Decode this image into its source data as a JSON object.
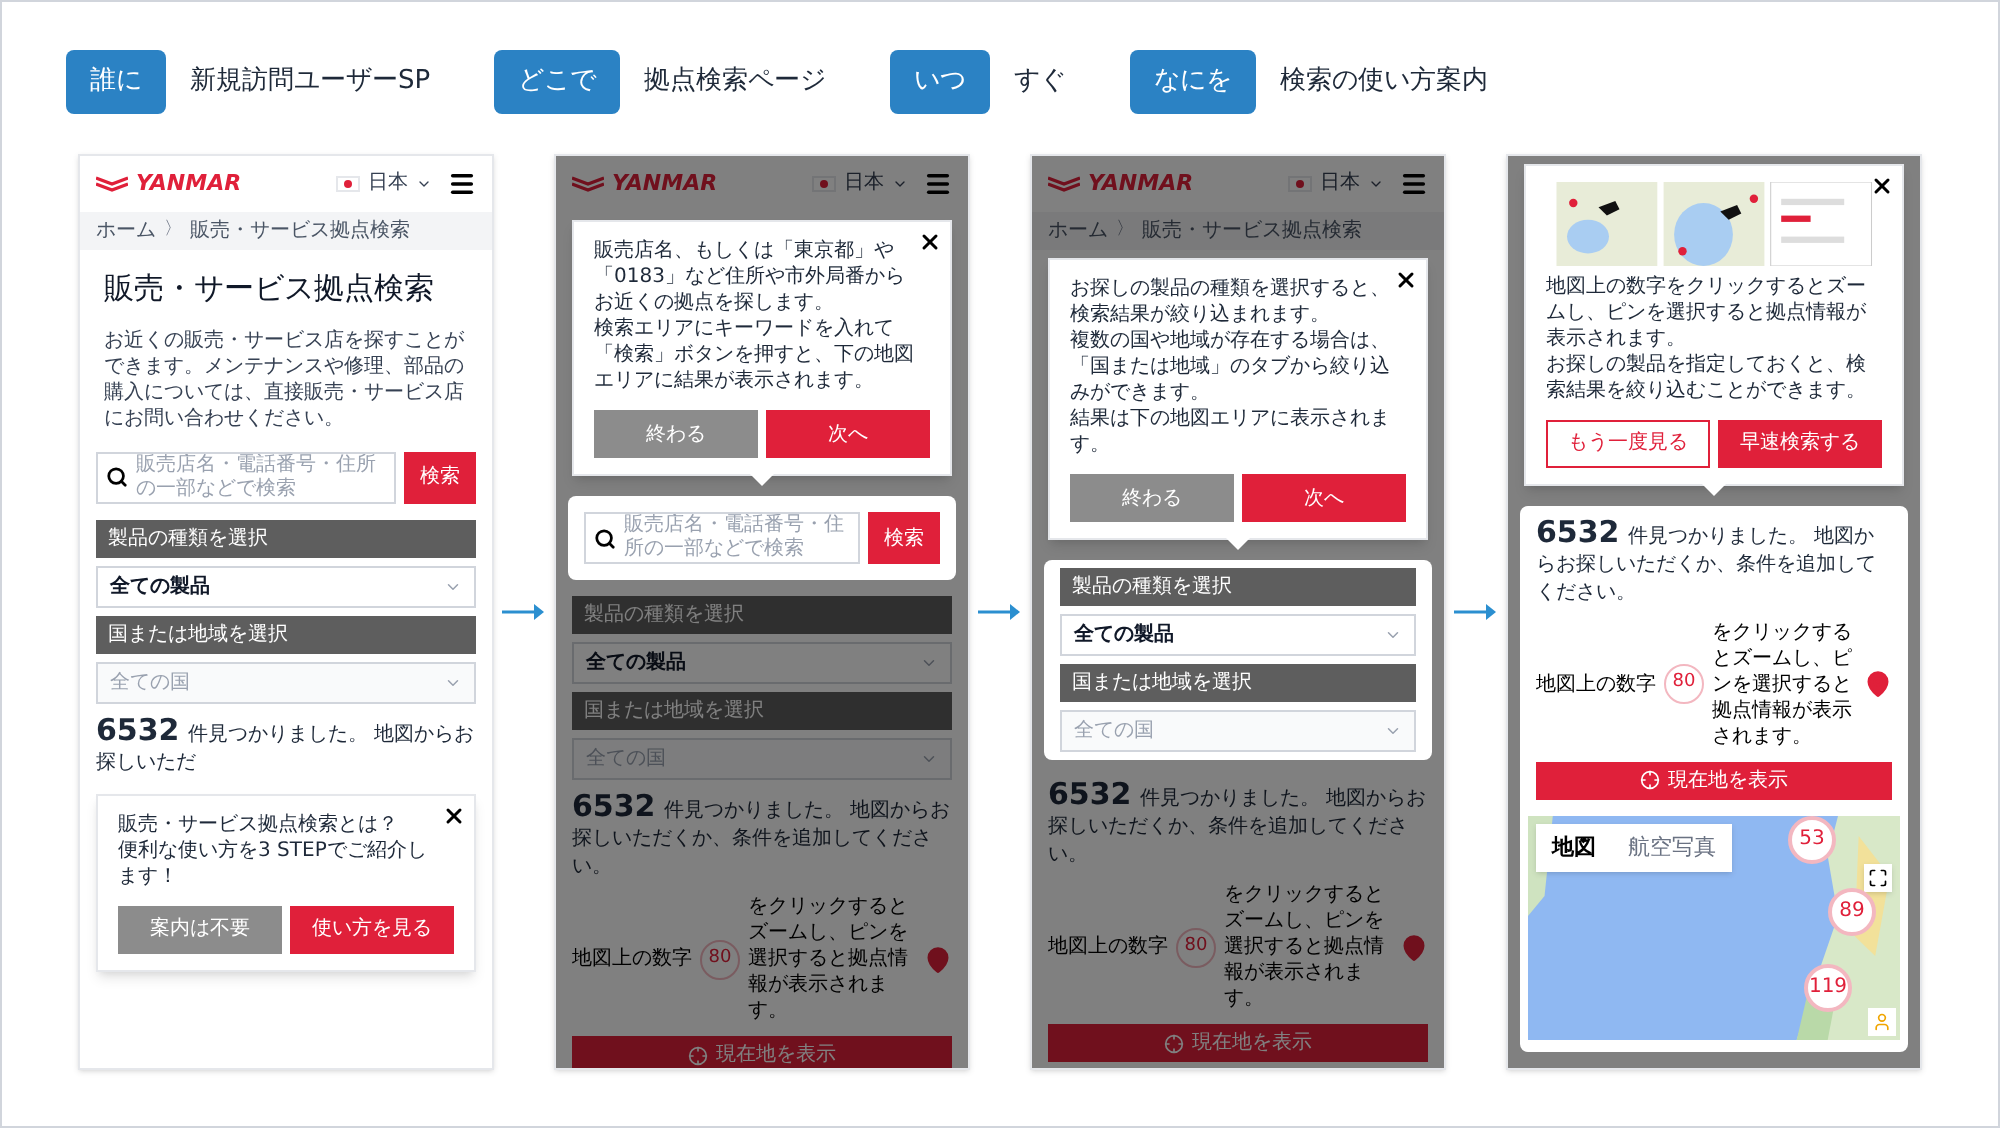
{
  "brief": [
    {
      "tag": "誰に",
      "value": "新規訪問ユーザーSP"
    },
    {
      "tag": "どこで",
      "value": "拠点検索ページ"
    },
    {
      "tag": "いつ",
      "value": "すぐ"
    },
    {
      "tag": "なにを",
      "value": "検索の使い方案内"
    }
  ],
  "screens": [
    {
      "dimmed": false,
      "blocks": [
        {
          "kind": "header",
          "logo": "YANMAR",
          "language": "日本"
        },
        {
          "kind": "breadcrumb",
          "items": [
            "ホーム",
            "販売・サービス拠点検索"
          ],
          "separator": "〉"
        },
        {
          "kind": "title",
          "text": "販売・サービス拠点検索"
        },
        {
          "kind": "paragraph",
          "text": "お近くの販売・サービス店を探すことができます。メンテナンスや修理、部品の購入については、直接販売・サービス店にお問い合わせください。"
        },
        {
          "kind": "search",
          "placeholder": "販売店名・電話番号・住所の一部などで検索",
          "button": "検索"
        },
        {
          "kind": "section",
          "label": "製品の種類を選択"
        },
        {
          "kind": "select",
          "value": "全ての製品",
          "disabled": false
        },
        {
          "kind": "section",
          "label": "国または地域を選択"
        },
        {
          "kind": "select",
          "value": "全ての国",
          "disabled": true
        },
        {
          "kind": "result",
          "count": "6532",
          "text": "件見つかりました。 地図からお探しいただ"
        },
        {
          "kind": "popup",
          "tail": false,
          "text": [
            "販売・サービス拠点検索とは？",
            "便利な使い方を3 STEPでご紹介します！"
          ],
          "buttons": [
            {
              "label": "案内は不要",
              "kind": "secondary"
            },
            {
              "label": "使い方を見る",
              "kind": "primary"
            }
          ]
        }
      ]
    },
    {
      "dimmed": true,
      "blocks": [
        {
          "kind": "header",
          "logo": "YANMAR",
          "language": "日本"
        },
        {
          "kind": "popup",
          "tail": true,
          "text": [
            "販売店名、もしくは「東京都」や「0183」など住所や市外局番からお近くの拠点を探します。",
            "検索エリアにキーワードを入れて「検索」ボタンを押すと、下の地図エリアに結果が表示されます。"
          ],
          "buttons": [
            {
              "label": "終わる",
              "kind": "secondary"
            },
            {
              "label": "次へ",
              "kind": "primary"
            }
          ]
        },
        {
          "kind": "spotlight",
          "blocks": [
            {
              "kind": "search",
              "placeholder": "販売店名・電話番号・住所の一部などで検索",
              "button": "検索"
            }
          ]
        },
        {
          "kind": "section",
          "label": "製品の種類を選択"
        },
        {
          "kind": "select",
          "value": "全ての製品",
          "disabled": false
        },
        {
          "kind": "section",
          "label": "国または地域を選択"
        },
        {
          "kind": "select",
          "value": "全ての国",
          "disabled": true
        },
        {
          "kind": "result",
          "count": "6532",
          "text": "件見つかりました。 地図からお探しいただくか、条件を追加してください。"
        },
        {
          "kind": "hint",
          "before": "地図上の数字",
          "marker": "80",
          "after": "をクリックするとズームし、ピンを選択すると拠点情報が表示されます。"
        },
        {
          "kind": "locate",
          "label": "現在地を表示"
        }
      ]
    },
    {
      "dimmed": true,
      "blocks": [
        {
          "kind": "header",
          "logo": "YANMAR",
          "language": "日本"
        },
        {
          "kind": "breadcrumb",
          "items": [
            "ホーム",
            "販売・サービス拠点検索"
          ],
          "separator": "〉"
        },
        {
          "kind": "popup",
          "tail": true,
          "text": [
            "お探しの製品の種類を選択すると、検索結果が絞り込まれます。",
            "複数の国や地域が存在する場合は、「国または地域」のタブから絞り込みができます。",
            "結果は下の地図エリアに表示されます。"
          ],
          "buttons": [
            {
              "label": "終わる",
              "kind": "secondary"
            },
            {
              "label": "次へ",
              "kind": "primary"
            }
          ]
        },
        {
          "kind": "spotlight",
          "blocks": [
            {
              "kind": "section",
              "label": "製品の種類を選択"
            },
            {
              "kind": "select",
              "value": "全ての製品",
              "disabled": false
            },
            {
              "kind": "section",
              "label": "国または地域を選択"
            },
            {
              "kind": "select",
              "value": "全ての国",
              "disabled": true
            }
          ]
        },
        {
          "kind": "result",
          "count": "6532",
          "text": "件見つかりました。 地図からお探しいただくか、条件を追加してください。"
        },
        {
          "kind": "hint",
          "before": "地図上の数字",
          "marker": "80",
          "after": "をクリックするとズームし、ピンを選択すると拠点情報が表示されます。"
        },
        {
          "kind": "locate",
          "label": "現在地を表示"
        }
      ]
    },
    {
      "dimmed": true,
      "blocks": [
        {
          "kind": "popup",
          "tail": true,
          "picture": true,
          "text": [
            "地図上の数字をクリックするとズームし、ピンを選択すると拠点情報が表示されます。",
            "お探しの製品を指定しておくと、検索結果を絞り込むことができます。"
          ],
          "buttons": [
            {
              "label": "もう一度見る",
              "kind": "outline"
            },
            {
              "label": "早速検索する",
              "kind": "primary"
            }
          ]
        },
        {
          "kind": "spotlight",
          "blocks": [
            {
              "kind": "result",
              "count": "6532",
              "text": "件見つかりました。 地図からお探しいただくか、条件を追加してください。"
            },
            {
              "kind": "hint",
              "before": "地図上の数字",
              "marker": "80",
              "after": "をクリックするとズームし、ピンを選択すると拠点情報が表示されます。"
            },
            {
              "kind": "locate",
              "label": "現在地を表示"
            },
            {
              "kind": "map",
              "tabs": [
                {
                  "label": "地図",
                  "selected": true
                },
                {
                  "label": "航空写真",
                  "selected": false
                }
              ],
              "clusters": [
                "53",
                "89",
                "119"
              ]
            }
          ]
        }
      ]
    }
  ]
}
